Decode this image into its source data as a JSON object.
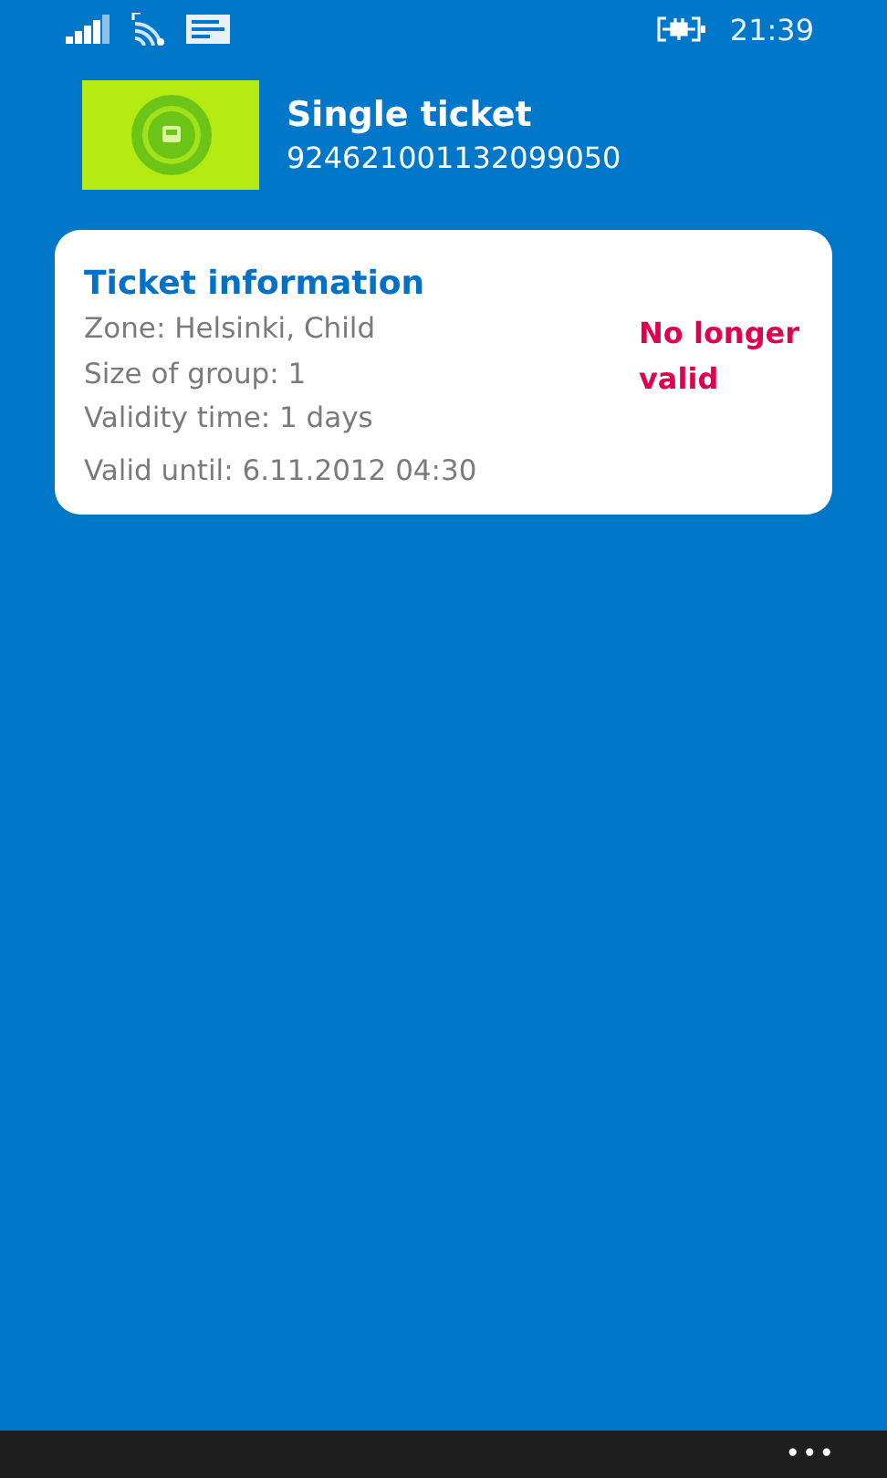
{
  "status_bar": {
    "time": "21:39"
  },
  "ticket": {
    "title": "Single ticket",
    "number": "924621001132099050"
  },
  "card": {
    "heading": "Ticket information",
    "lines": [
      "Zone: Helsinki, Child",
      "Size of group: 1",
      "Validity time: 1 days"
    ],
    "valid_until": "Valid until: 6.11.2012 04:30",
    "status": "No longer valid"
  },
  "app_bar": {
    "more": "•••"
  }
}
